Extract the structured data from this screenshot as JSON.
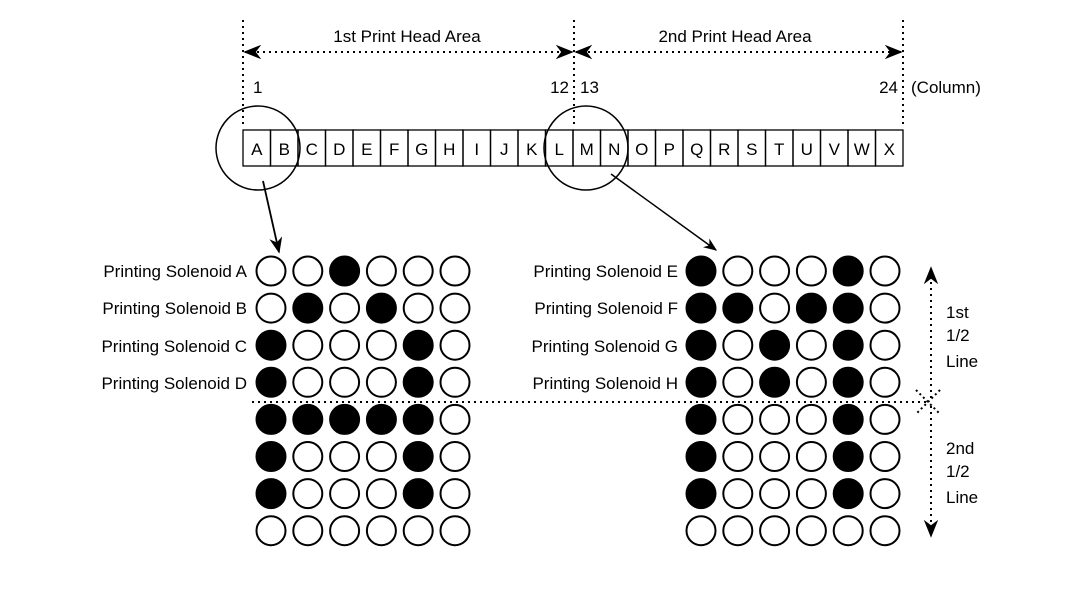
{
  "areas": {
    "first_head": "1st Print Head Area",
    "second_head": "2nd Print Head Area"
  },
  "column_numbers": {
    "start_first": "1",
    "end_first": "12",
    "start_second": "13",
    "end_second": "24",
    "unit_label": "(Column)"
  },
  "columns": [
    "A",
    "B",
    "C",
    "D",
    "E",
    "F",
    "G",
    "H",
    "I",
    "J",
    "K",
    "L",
    "M",
    "N",
    "O",
    "P",
    "Q",
    "R",
    "S",
    "T",
    "U",
    "V",
    "W",
    "X"
  ],
  "solenoid_labels": {
    "left": [
      "Printing Solenoid A",
      "Printing Solenoid B",
      "Printing Solenoid C",
      "Printing Solenoid D"
    ],
    "right": [
      "Printing Solenoid E",
      "Printing Solenoid F",
      "Printing Solenoid G",
      "Printing Solenoid H"
    ]
  },
  "dot_patterns": {
    "left": [
      [
        0,
        0,
        1,
        0,
        0,
        0
      ],
      [
        0,
        1,
        0,
        1,
        0,
        0
      ],
      [
        1,
        0,
        0,
        0,
        1,
        0
      ],
      [
        1,
        0,
        0,
        0,
        1,
        0
      ],
      [
        1,
        1,
        1,
        1,
        1,
        0
      ],
      [
        1,
        0,
        0,
        0,
        1,
        0
      ],
      [
        1,
        0,
        0,
        0,
        1,
        0
      ],
      [
        0,
        0,
        0,
        0,
        0,
        0
      ]
    ],
    "right": [
      [
        1,
        0,
        0,
        0,
        1,
        0
      ],
      [
        1,
        1,
        0,
        1,
        1,
        0
      ],
      [
        1,
        0,
        1,
        0,
        1,
        0
      ],
      [
        1,
        0,
        1,
        0,
        1,
        0
      ],
      [
        1,
        0,
        0,
        0,
        1,
        0
      ],
      [
        1,
        0,
        0,
        0,
        1,
        0
      ],
      [
        1,
        0,
        0,
        0,
        1,
        0
      ],
      [
        0,
        0,
        0,
        0,
        0,
        0
      ]
    ]
  },
  "half_lines": {
    "first": [
      "1st",
      "1/2",
      "Line"
    ],
    "second": [
      "2nd",
      "1/2",
      "Line"
    ]
  }
}
